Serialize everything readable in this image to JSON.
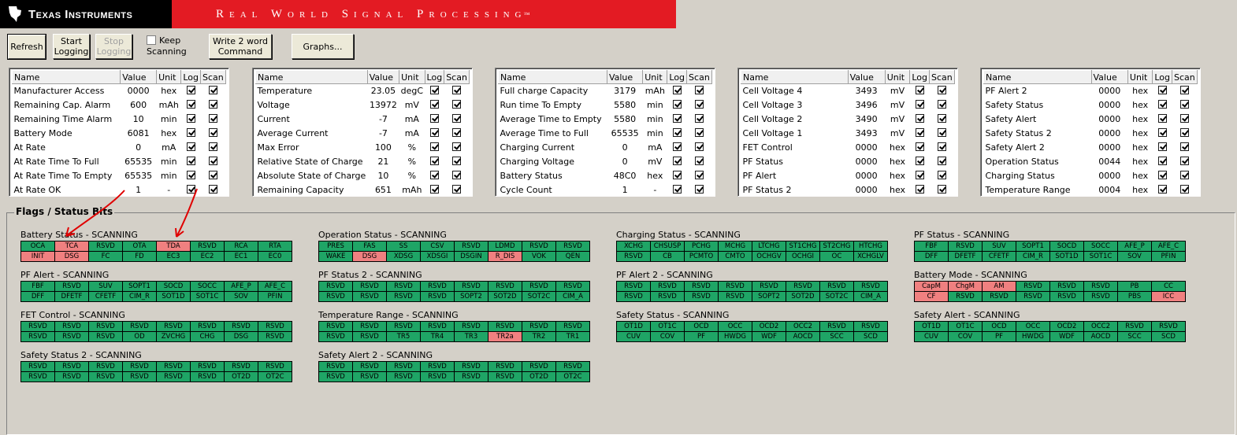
{
  "header": {
    "company": "Texas Instruments",
    "banner": "Real World Signal Processing",
    "tm": "™"
  },
  "toolbar": {
    "refresh": "Refresh",
    "start_logging": "Start\nLogging",
    "stop_logging": "Stop\nLogging",
    "keep_scanning": "Keep\nScanning",
    "write_word": "Write 2 word\nCommand",
    "graphs": "Graphs..."
  },
  "table_headers": [
    "Name",
    "Value",
    "Unit",
    "Log",
    "Scan"
  ],
  "tables": [
    {
      "rows": [
        [
          "Manufacturer Access",
          "0000",
          "hex"
        ],
        [
          "Remaining Cap. Alarm",
          "600",
          "mAh"
        ],
        [
          "Remaining Time Alarm",
          "10",
          "min"
        ],
        [
          "Battery Mode",
          "6081",
          "hex"
        ],
        [
          "At Rate",
          "0",
          "mA"
        ],
        [
          "At Rate Time To Full",
          "65535",
          "min"
        ],
        [
          "At Rate Time To Empty",
          "65535",
          "min"
        ],
        [
          "At Rate OK",
          "1",
          "-"
        ]
      ]
    },
    {
      "rows": [
        [
          "Temperature",
          "23.05",
          "degC"
        ],
        [
          "Voltage",
          "13972",
          "mV"
        ],
        [
          "Current",
          "-7",
          "mA"
        ],
        [
          "Average Current",
          "-7",
          "mA"
        ],
        [
          "Max Error",
          "100",
          "%"
        ],
        [
          "Relative State of Charge",
          "21",
          "%"
        ],
        [
          "Absolute State of Charge",
          "10",
          "%"
        ],
        [
          "Remaining Capacity",
          "651",
          "mAh"
        ]
      ]
    },
    {
      "rows": [
        [
          "Full charge Capacity",
          "3179",
          "mAh"
        ],
        [
          "Run time To Empty",
          "5580",
          "min"
        ],
        [
          "Average Time to Empty",
          "5580",
          "min"
        ],
        [
          "Average Time to Full",
          "65535",
          "min"
        ],
        [
          "Charging Current",
          "0",
          "mA"
        ],
        [
          "Charging Voltage",
          "0",
          "mV"
        ],
        [
          "Battery Status",
          "48C0",
          "hex"
        ],
        [
          "Cycle Count",
          "1",
          "-"
        ]
      ]
    },
    {
      "rows": [
        [
          "Cell Voltage 4",
          "3493",
          "mV"
        ],
        [
          "Cell Voltage 3",
          "3496",
          "mV"
        ],
        [
          "Cell Voltage 2",
          "3490",
          "mV"
        ],
        [
          "Cell Voltage 1",
          "3493",
          "mV"
        ],
        [
          "FET Control",
          "0000",
          "hex"
        ],
        [
          "PF Status",
          "0000",
          "hex"
        ],
        [
          "PF Alert",
          "0000",
          "hex"
        ],
        [
          "PF Status 2",
          "0000",
          "hex"
        ]
      ]
    },
    {
      "rows": [
        [
          "PF Alert 2",
          "0000",
          "hex"
        ],
        [
          "Safety Status",
          "0000",
          "hex"
        ],
        [
          "Safety Alert",
          "0000",
          "hex"
        ],
        [
          "Safety Status 2",
          "0000",
          "hex"
        ],
        [
          "Safety Alert 2",
          "0000",
          "hex"
        ],
        [
          "Operation Status",
          "0044",
          "hex"
        ],
        [
          "Charging Status",
          "0000",
          "hex"
        ],
        [
          "Temperature Range",
          "0004",
          "hex"
        ]
      ]
    }
  ],
  "flags_title": "Flags / Status Bits",
  "flag_groups": [
    {
      "title": "Battery Status - SCANNING",
      "bits": [
        "OCA",
        "TCA",
        "RSVD",
        "OTA",
        "TDA",
        "RSVD",
        "RCA",
        "RTA",
        "INIT",
        "DSG",
        "FC",
        "FD",
        "EC3",
        "EC2",
        "EC1",
        "EC0"
      ],
      "on": [
        1,
        4,
        8,
        9
      ]
    },
    {
      "title": "Operation Status - SCANNING",
      "bits": [
        "PRES",
        "FAS",
        "SS",
        "CSV",
        "RSVD",
        "LDMD",
        "RSVD",
        "RSVD",
        "WAKE",
        "DSG",
        "XDSG",
        "XDSGI",
        "DSGIN",
        "R_DIS",
        "VOK",
        "QEN"
      ],
      "on": [
        9,
        13
      ]
    },
    {
      "title": "Charging Status - SCANNING",
      "bits": [
        "XCHG",
        "CHSUSP",
        "PCHG",
        "MCHG",
        "LTCHG",
        "ST1CHG",
        "ST2CHG",
        "HTCHG",
        "RSVD",
        "CB",
        "PCMTO",
        "CMTO",
        "OCHGV",
        "OCHGI",
        "OC",
        "XCHGLV"
      ],
      "on": []
    },
    {
      "title": "PF Status - SCANNING",
      "bits": [
        "FBF",
        "RSVD",
        "SUV",
        "SOPT1",
        "SOCD",
        "SOCC",
        "AFE_P",
        "AFE_C",
        "DFF",
        "DFETF",
        "CFETF",
        "CIM_R",
        "SOT1D",
        "SOT1C",
        "SOV",
        "PFIN"
      ],
      "on": []
    },
    {
      "title": "PF Alert - SCANNING",
      "bits": [
        "FBF",
        "RSVD",
        "SUV",
        "SOPT1",
        "SOCD",
        "SOCC",
        "AFE_P",
        "AFE_C",
        "DFF",
        "DFETF",
        "CFETF",
        "CIM_R",
        "SOT1D",
        "SOT1C",
        "SOV",
        "PFIN"
      ],
      "on": []
    },
    {
      "title": "PF Status 2 - SCANNING",
      "bits": [
        "RSVD",
        "RSVD",
        "RSVD",
        "RSVD",
        "RSVD",
        "RSVD",
        "RSVD",
        "RSVD",
        "RSVD",
        "RSVD",
        "RSVD",
        "RSVD",
        "SOPT2",
        "SOT2D",
        "SOT2C",
        "CIM_A"
      ],
      "on": []
    },
    {
      "title": "PF Alert 2 - SCANNING",
      "bits": [
        "RSVD",
        "RSVD",
        "RSVD",
        "RSVD",
        "RSVD",
        "RSVD",
        "RSVD",
        "RSVD",
        "RSVD",
        "RSVD",
        "RSVD",
        "RSVD",
        "SOPT2",
        "SOT2D",
        "SOT2C",
        "CIM_A"
      ],
      "on": []
    },
    {
      "title": "Battery Mode - SCANNING",
      "bits": [
        "CapM",
        "ChgM",
        "AM",
        "RSVD",
        "RSVD",
        "RSVD",
        "PB",
        "CC",
        "CF",
        "RSVD",
        "RSVD",
        "RSVD",
        "RSVD",
        "RSVD",
        "PBS",
        "ICC"
      ],
      "on": [
        0,
        1,
        2,
        8,
        15
      ]
    },
    {
      "title": "FET Control - SCANNING",
      "bits": [
        "RSVD",
        "RSVD",
        "RSVD",
        "RSVD",
        "RSVD",
        "RSVD",
        "RSVD",
        "RSVD",
        "RSVD",
        "RSVD",
        "RSVD",
        "OD",
        "ZVCHG",
        "CHG",
        "DSG",
        "RSVD"
      ],
      "on": []
    },
    {
      "title": "Temperature Range - SCANNING",
      "bits": [
        "RSVD",
        "RSVD",
        "RSVD",
        "RSVD",
        "RSVD",
        "RSVD",
        "RSVD",
        "RSVD",
        "RSVD",
        "RSVD",
        "TR5",
        "TR4",
        "TR3",
        "TR2a",
        "TR2",
        "TR1"
      ],
      "on": [
        13
      ]
    },
    {
      "title": "Safety Status - SCANNING",
      "bits": [
        "OT1D",
        "OT1C",
        "OCD",
        "OCC",
        "OCD2",
        "OCC2",
        "RSVD",
        "RSVD",
        "CUV",
        "COV",
        "PF",
        "HWDG",
        "WDF",
        "AOCD",
        "SCC",
        "SCD"
      ],
      "on": []
    },
    {
      "title": "Safety Alert - SCANNING",
      "bits": [
        "OT1D",
        "OT1C",
        "OCD",
        "OCC",
        "OCD2",
        "OCC2",
        "RSVD",
        "RSVD",
        "CUV",
        "COV",
        "PF",
        "HWDG",
        "WDF",
        "AOCD",
        "SCC",
        "SCD"
      ],
      "on": []
    },
    {
      "title": "Safety Status 2 - SCANNING",
      "bits": [
        "RSVD",
        "RSVD",
        "RSVD",
        "RSVD",
        "RSVD",
        "RSVD",
        "RSVD",
        "RSVD",
        "RSVD",
        "RSVD",
        "RSVD",
        "RSVD",
        "RSVD",
        "RSVD",
        "OT2D",
        "OT2C"
      ],
      "on": []
    },
    {
      "title": "Safety Alert 2 - SCANNING",
      "bits": [
        "RSVD",
        "RSVD",
        "RSVD",
        "RSVD",
        "RSVD",
        "RSVD",
        "RSVD",
        "RSVD",
        "RSVD",
        "RSVD",
        "RSVD",
        "RSVD",
        "RSVD",
        "RSVD",
        "OT2D",
        "OT2C"
      ],
      "on": []
    }
  ],
  "colors": {
    "flag_off": "#1fa566",
    "flag_on": "#f08080",
    "banner": "#e31b23",
    "annotation": "#e00000"
  }
}
